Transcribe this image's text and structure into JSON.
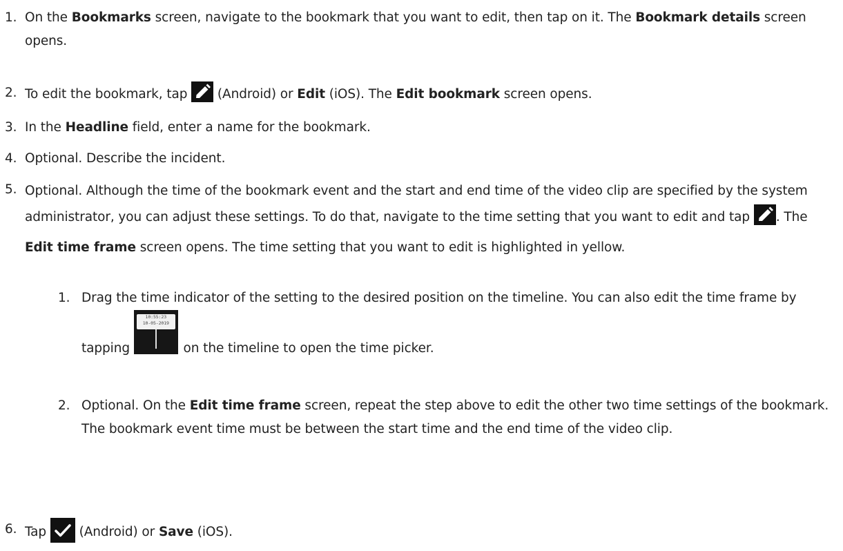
{
  "steps": [
    {
      "number": "1.",
      "parts": {
        "t1": "On the ",
        "b1": "Bookmarks",
        "t2": " screen, navigate to the bookmark that you want to edit, then tap on it. The ",
        "b2": "Bookmark details",
        "t3": " screen opens."
      }
    },
    {
      "number": "2.",
      "parts": {
        "t1": "To edit the bookmark, tap ",
        "icon": "pencil-icon",
        "t2": " (Android) or ",
        "b1": "Edit",
        "t3": " (iOS). The ",
        "b2": "Edit bookmark",
        "t4": " screen opens."
      }
    },
    {
      "number": "3.",
      "parts": {
        "t1": "In the ",
        "b1": "Headline",
        "t2": " field, enter a name for the bookmark."
      }
    },
    {
      "number": "4.",
      "parts": {
        "t1": "Optional. Describe the incident."
      }
    },
    {
      "number": "5.",
      "parts": {
        "t1": "Optional. Although the time of the bookmark event and the start and end time of the video clip are specified by the system administrator, you can adjust these settings. To do that, navigate to the time setting that you want to edit and tap ",
        "icon": "pencil-icon",
        "t2": ". The ",
        "b1": "Edit time frame",
        "t3": " screen opens. The time setting that you want to edit is highlighted in yellow."
      },
      "substeps": [
        {
          "number": "1.",
          "parts": {
            "t1": "Drag the time indicator of the setting to the desired position on the timeline. You can also edit the time frame by tapping ",
            "icon": "time-indicator-icon",
            "icon_time": "10:55:23",
            "icon_date": "10-05-2019",
            "t2": " on the timeline to open the time picker."
          }
        },
        {
          "number": "2.",
          "parts": {
            "t1": "Optional. On the ",
            "b1": "Edit time frame",
            "t2": " screen, repeat the step above to edit the other two time settings of the bookmark. The bookmark event time must be between the start time and the end time of the video clip."
          }
        }
      ]
    },
    {
      "number": "6.",
      "parts": {
        "t1": "Tap ",
        "icon": "checkmark-icon",
        "t2": " (Android) or ",
        "b1": "Save",
        "t3": " (iOS)."
      }
    }
  ]
}
